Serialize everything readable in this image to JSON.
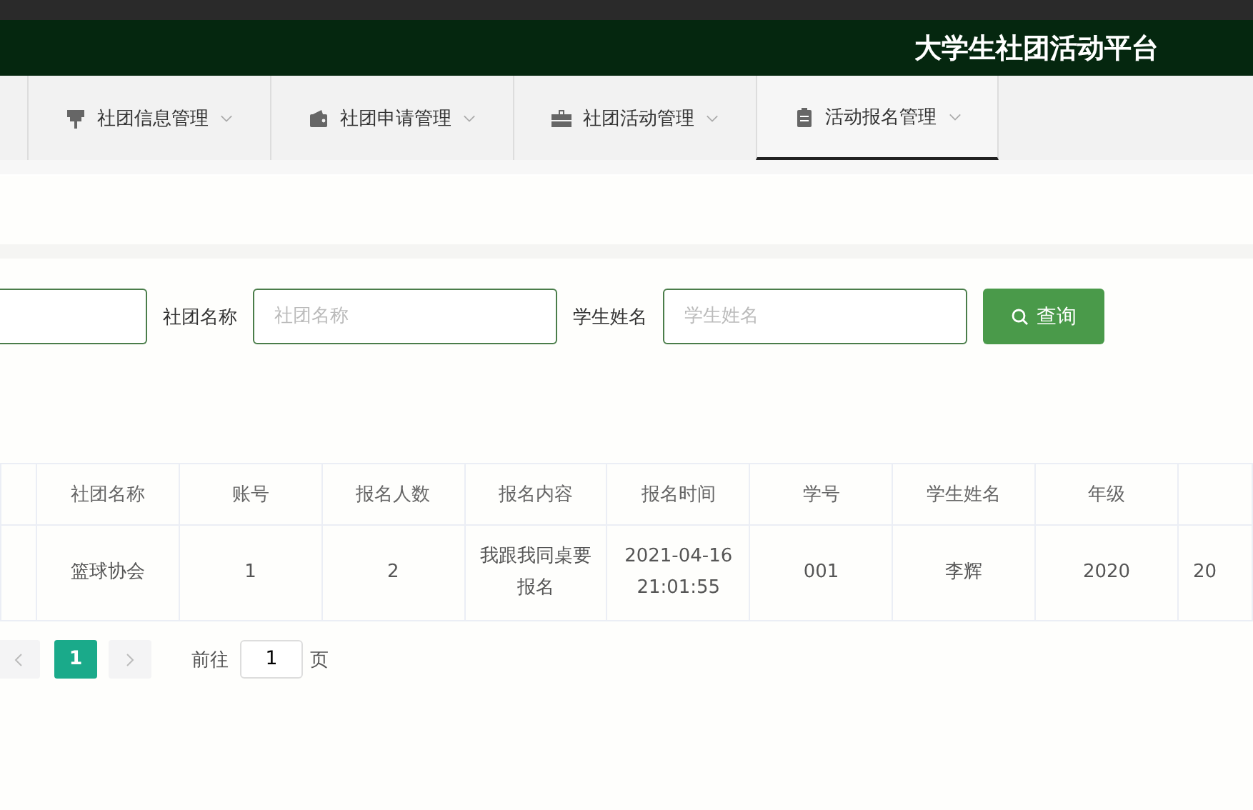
{
  "header": {
    "title": "大学生社团活动平台"
  },
  "nav": [
    {
      "label": "社团信息管理",
      "selected": false
    },
    {
      "label": "社团申请管理",
      "selected": false
    },
    {
      "label": "社团活动管理",
      "selected": false
    },
    {
      "label": "活动报名管理",
      "selected": true
    }
  ],
  "filters": [
    {
      "label": "社团名称",
      "placeholder": "社团名称"
    },
    {
      "label": "学生姓名",
      "placeholder": "学生姓名"
    }
  ],
  "search_button": "查询",
  "table": {
    "columns": [
      "社团名称",
      "账号",
      "报名人数",
      "报名内容",
      "报名时间",
      "学号",
      "学生姓名",
      "年级"
    ],
    "rows": [
      {
        "cells": [
          "篮球协会",
          "1",
          "2",
          "我跟我同桌要报名",
          "2021-04-16 21:01:55",
          "001",
          "李辉",
          "2020"
        ],
        "column_10": "20"
      }
    ]
  },
  "pagination": {
    "pages": [
      {
        "label": "1",
        "selected": true
      }
    ],
    "goto_label": "前往",
    "goto_value": "1",
    "page_suffix": "页"
  }
}
